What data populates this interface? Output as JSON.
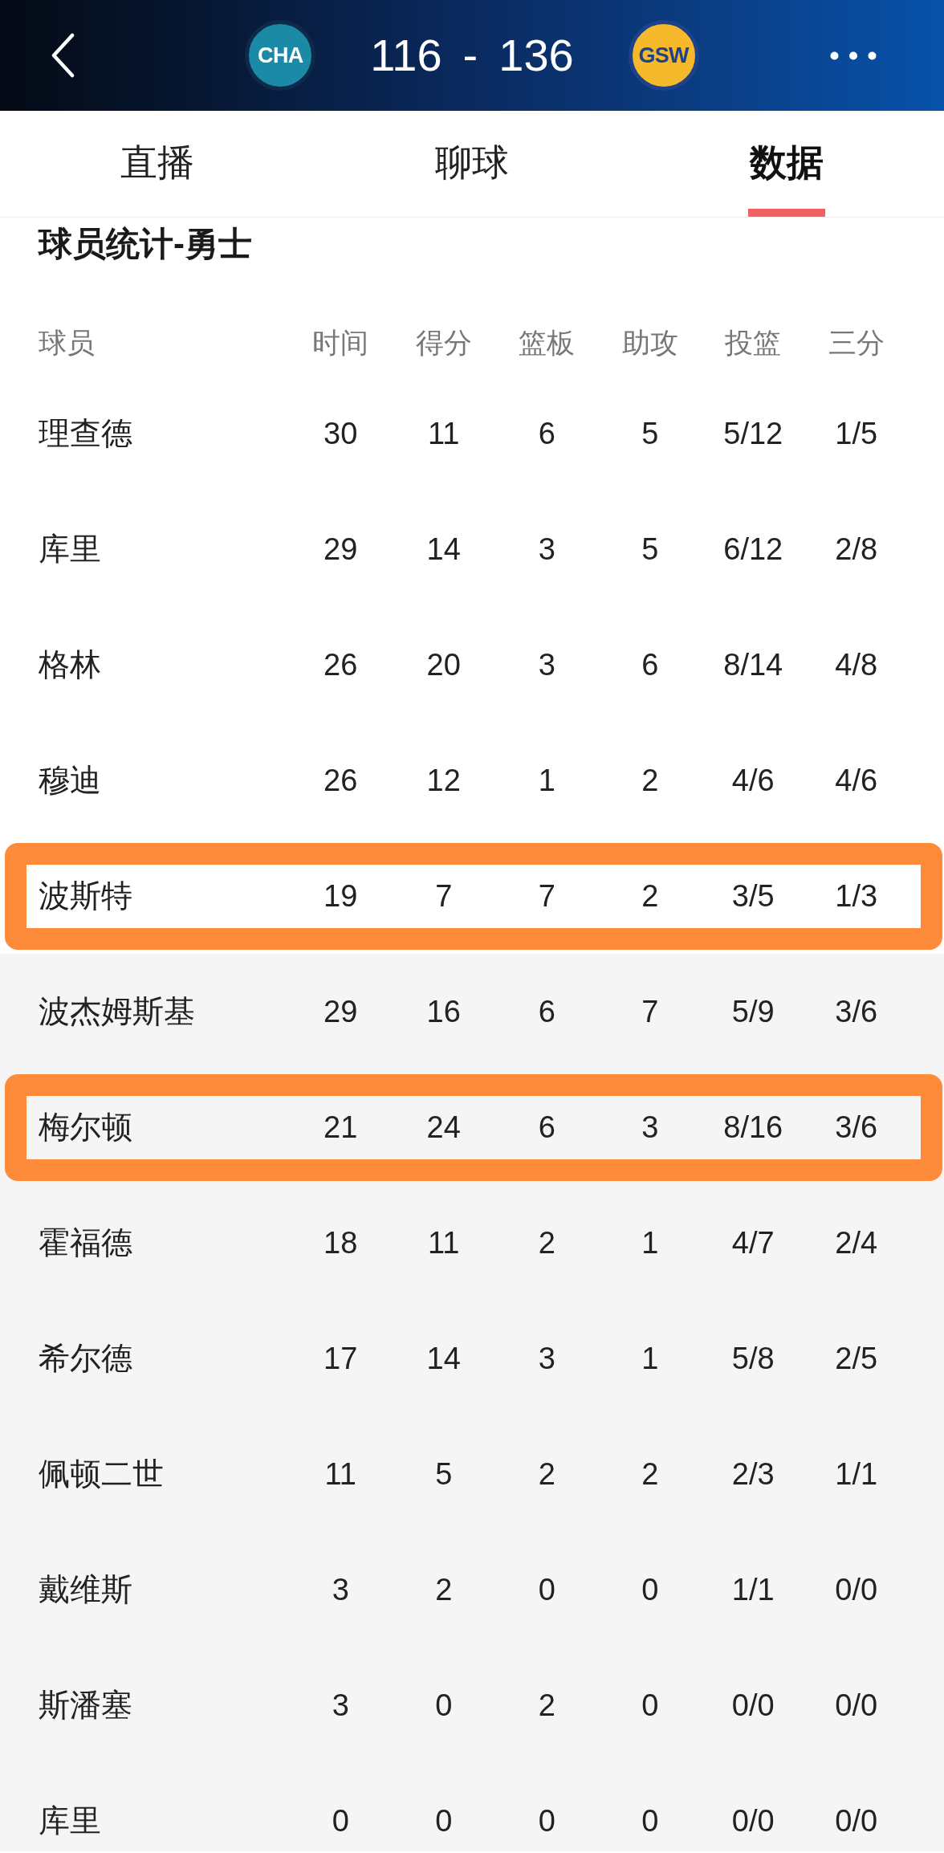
{
  "header": {
    "home_team": {
      "abbr": "CHA"
    },
    "score": {
      "home": "116",
      "separator": "-",
      "away": "136"
    },
    "away_team": {
      "abbr": "GSW"
    }
  },
  "tabs": [
    {
      "label": "直播",
      "selected": false
    },
    {
      "label": "聊球",
      "selected": false
    },
    {
      "label": "数据",
      "selected": true
    }
  ],
  "section_title": "球员统计-勇士",
  "table": {
    "columns": [
      "球员",
      "时间",
      "得分",
      "篮板",
      "助攻",
      "投篮",
      "三分"
    ],
    "rows": [
      {
        "cells": [
          "理查德",
          "30",
          "11",
          "6",
          "5",
          "5/12",
          "1/5"
        ],
        "starter": true,
        "highlighted": false
      },
      {
        "cells": [
          "库里",
          "29",
          "14",
          "3",
          "5",
          "6/12",
          "2/8"
        ],
        "starter": true,
        "highlighted": false
      },
      {
        "cells": [
          "格林",
          "26",
          "20",
          "3",
          "6",
          "8/14",
          "4/8"
        ],
        "starter": true,
        "highlighted": false
      },
      {
        "cells": [
          "穆迪",
          "26",
          "12",
          "1",
          "2",
          "4/6",
          "4/6"
        ],
        "starter": true,
        "highlighted": false
      },
      {
        "cells": [
          "波斯特",
          "19",
          "7",
          "7",
          "2",
          "3/5",
          "1/3"
        ],
        "starter": true,
        "highlighted": true
      },
      {
        "cells": [
          "波杰姆斯基",
          "29",
          "16",
          "6",
          "7",
          "5/9",
          "3/6"
        ],
        "starter": false,
        "highlighted": false
      },
      {
        "cells": [
          "梅尔顿",
          "21",
          "24",
          "6",
          "3",
          "8/16",
          "3/6"
        ],
        "starter": false,
        "highlighted": true
      },
      {
        "cells": [
          "霍福德",
          "18",
          "11",
          "2",
          "1",
          "4/7",
          "2/4"
        ],
        "starter": false,
        "highlighted": false
      },
      {
        "cells": [
          "希尔德",
          "17",
          "14",
          "3",
          "1",
          "5/8",
          "2/5"
        ],
        "starter": false,
        "highlighted": false
      },
      {
        "cells": [
          "佩顿二世",
          "11",
          "5",
          "2",
          "2",
          "2/3",
          "1/1"
        ],
        "starter": false,
        "highlighted": false
      },
      {
        "cells": [
          "戴维斯",
          "3",
          "2",
          "0",
          "0",
          "1/1",
          "0/0"
        ],
        "starter": false,
        "highlighted": false
      },
      {
        "cells": [
          "斯潘塞",
          "3",
          "0",
          "2",
          "0",
          "0/0",
          "0/0"
        ],
        "starter": false,
        "highlighted": false
      },
      {
        "cells": [
          "库里",
          "0",
          "0",
          "0",
          "0",
          "0/0",
          "0/0"
        ],
        "starter": false,
        "highlighted": false
      }
    ]
  }
}
